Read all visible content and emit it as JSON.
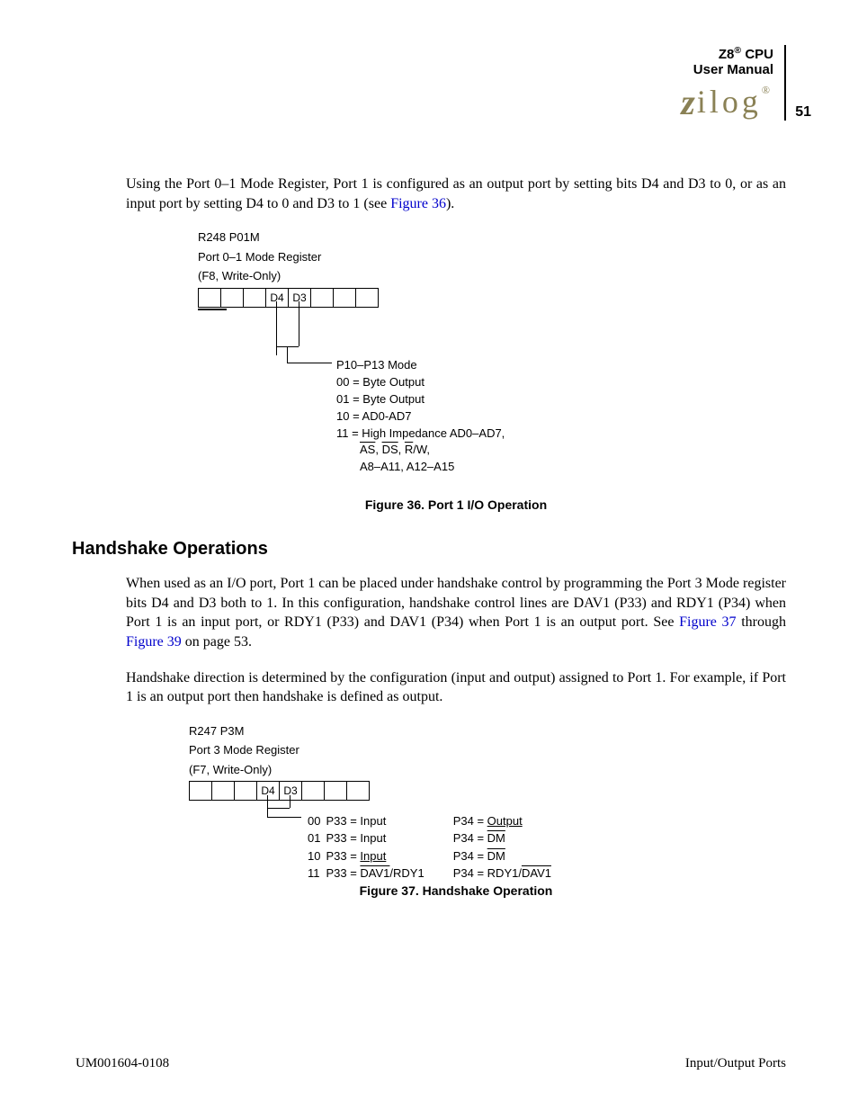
{
  "header": {
    "line1_prefix": "Z8",
    "line1_sup": "®",
    "line1_suffix": " CPU",
    "line2": "User Manual",
    "page_number": "51"
  },
  "para1_a": "Using the Port 0–1 Mode Register, Port 1 is configured as an output port by setting bits D4 and D3 to 0, or as an input port by setting D4 to 0 and D3 to 1 (see ",
  "para1_link": "Figure 36",
  "para1_b": ").",
  "fig36": {
    "l1": "R248  P01M",
    "l2": "Port 0–1 Mode Register",
    "l3": "(F8, Write-Only)",
    "bits": [
      "",
      "",
      "",
      "D4",
      "D3",
      "",
      "",
      ""
    ],
    "m1": "P10–P13 Mode",
    "m2": "00 = Byte Output",
    "m3": "01 = Byte Output",
    "m4": "10 = AD0-AD7",
    "m5": "11 = High Impedance AD0–AD7,",
    "m6a": "AS",
    "m6b": ", ",
    "m6c": "DS",
    "m6d": ", ",
    "m6e": "R",
    "m6f": "/W,",
    "m7": "A8–A11, A12–A15",
    "caption": "Figure 36. Port 1 I/O Operation"
  },
  "section_heading": "Handshake Operations",
  "para2_a": "When used as an I/O port, Port 1 can be placed under handshake control by programming the Port 3 Mode register bits D4 and D3 both to 1. In this configuration, handshake control lines are DAV1 (P33) and RDY1 (P34) when Port 1 is an input port, or RDY1 (P33) and DAV1 (P34) when Port 1 is an output port. See ",
  "para2_link1": "Figure 37",
  "para2_mid": " through ",
  "para2_link2": "Figure 39",
  "para2_b": " on page 53.",
  "para3": "Handshake direction is determined by the configuration (input and output) assigned to Port 1. For example, if Port 1 is an output port then handshake is defined as output.",
  "fig37": {
    "l1": "R247  P3M",
    "l2": "Port 3 Mode Register",
    "l3": "(F7, Write-Only)",
    "bits": [
      "",
      "",
      "",
      "D4",
      "D3",
      "",
      "",
      ""
    ],
    "rows": [
      {
        "code": "00",
        "p33pre": "P33 = ",
        "p33u": "",
        "p33post": "Input",
        "p34pre": "P34 = ",
        "p34u": "",
        "p34post": "Output",
        "p34over": ""
      },
      {
        "code": "01",
        "p33pre": "P33 = ",
        "p33u": "",
        "p33post": "Input",
        "p34pre": "P34 = ",
        "p34u": "",
        "p34post": "",
        "p34over": "DM"
      },
      {
        "code": "10",
        "p33pre": "P33 = ",
        "p33u": "Input",
        "p33post": "",
        "p34pre": "P34 = ",
        "p34u": "",
        "p34post": "",
        "p34over": "DM"
      },
      {
        "code": "11",
        "p33pre": "P33 = ",
        "p33over": "DAV1",
        "p33post": "/RDY1",
        "p34pre": "P34 = RDY1/",
        "p34over": "DAV1",
        "p34post": ""
      }
    ],
    "caption": "Figure 37. Handshake Operation"
  },
  "footer": {
    "left": "UM001604-0108",
    "right": "Input/Output Ports"
  }
}
